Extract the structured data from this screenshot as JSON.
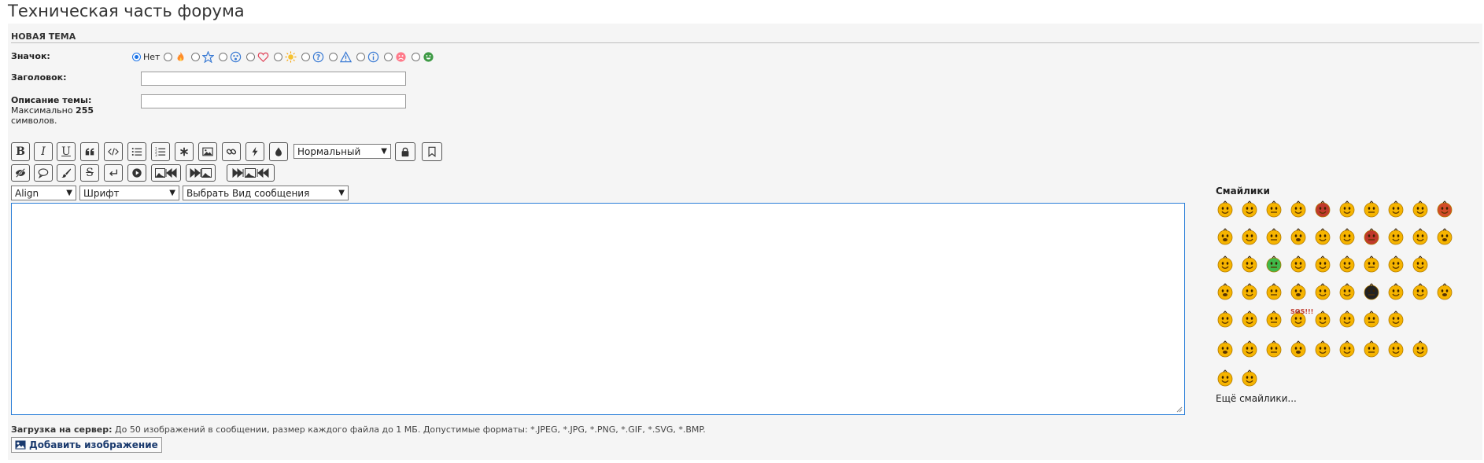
{
  "page": {
    "title": "Техническая часть форума"
  },
  "form": {
    "header": "НОВАЯ ТЕМА",
    "icon_label": "Значок:",
    "icon_none_label": "Нет",
    "icons": [
      "fire-icon",
      "star-icon",
      "surprised-face-icon",
      "heart-icon",
      "sun-icon",
      "question-icon",
      "warning-icon",
      "info-icon",
      "sad-face-icon",
      "happy-green-face-icon"
    ],
    "title_label": "Заголовок:",
    "title_value": "",
    "desc_label": "Описание темы:",
    "desc_hint_prefix": "Максимально",
    "desc_hint_number": "255",
    "desc_hint_suffix": "символов.",
    "desc_value": ""
  },
  "toolbar": {
    "size_select": "Нормальный",
    "align_select": "Align",
    "font_select": "Шрифт",
    "type_select": "Выбрать Вид сообщения"
  },
  "smilies": {
    "title": "Смайлики",
    "count": 58,
    "more": "Ещё смайлики...",
    "sos_text": "SOS!!!"
  },
  "upload": {
    "label": "Загрузка на сервер:",
    "text": "До 50 изображений в сообщении, размер каждого файла до 1 МБ. Допустимые форматы: *.JPEG, *.JPG, *.PNG, *.GIF, *.SVG, *.BMP.",
    "button": "Добавить изображение"
  },
  "colors": {
    "accent": "#2a7ed8",
    "panel": "#f5f5f5",
    "smiley": "#f6b400"
  }
}
